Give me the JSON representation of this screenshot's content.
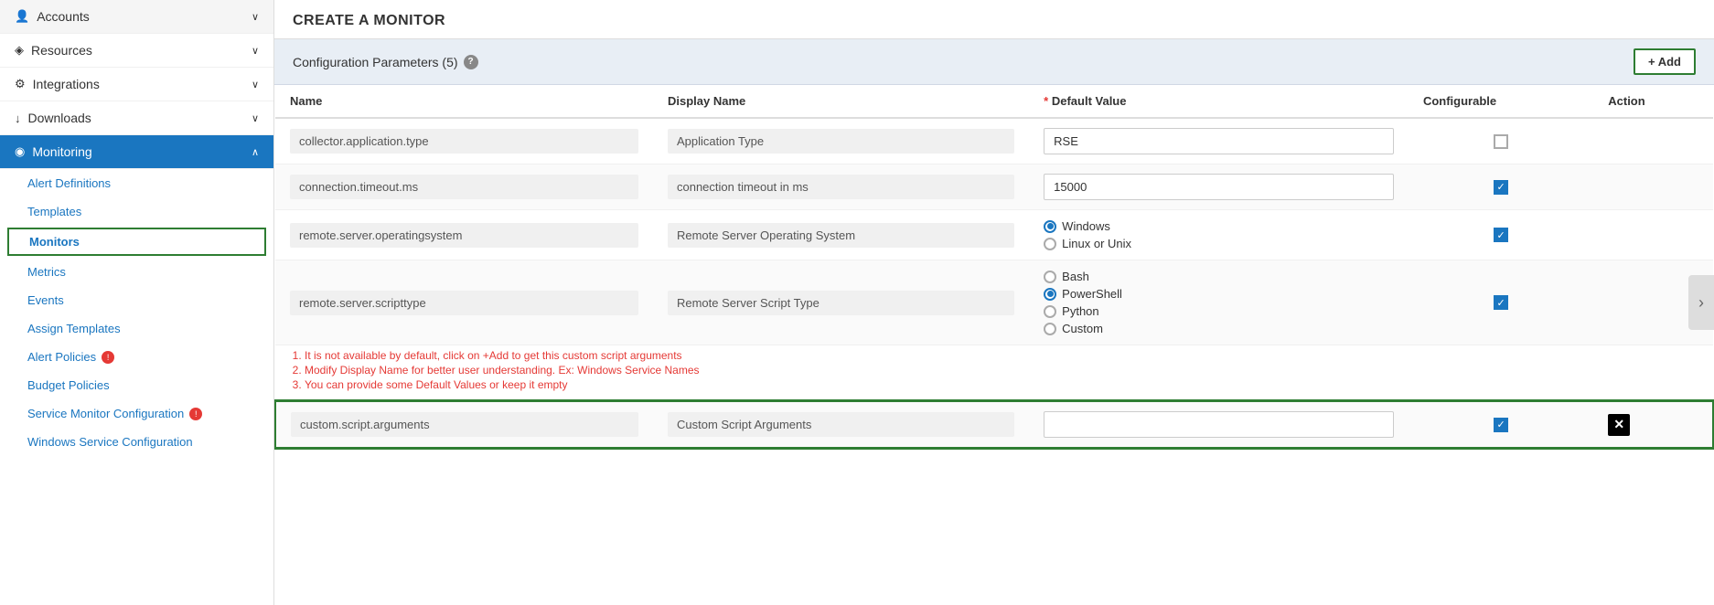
{
  "sidebar": {
    "items": [
      {
        "id": "accounts",
        "label": "Accounts",
        "icon": "👤",
        "chevron": "∨",
        "active": false,
        "level": 0
      },
      {
        "id": "resources",
        "label": "Resources",
        "icon": "◈",
        "chevron": "∨",
        "active": false,
        "level": 0
      },
      {
        "id": "integrations",
        "label": "Integrations",
        "icon": "⚙",
        "chevron": "∨",
        "active": false,
        "level": 0
      },
      {
        "id": "downloads",
        "label": "Downloads",
        "icon": "↓",
        "chevron": "∨",
        "active": false,
        "level": 0
      },
      {
        "id": "monitoring",
        "label": "Monitoring",
        "icon": "◉",
        "chevron": "∧",
        "active": true,
        "level": 0
      }
    ],
    "sub_items": [
      {
        "id": "alert-definitions",
        "label": "Alert Definitions",
        "highlighted": false,
        "badge": false
      },
      {
        "id": "templates",
        "label": "Templates",
        "highlighted": false,
        "badge": false
      },
      {
        "id": "monitors",
        "label": "Monitors",
        "highlighted": true,
        "badge": false
      },
      {
        "id": "metrics",
        "label": "Metrics",
        "highlighted": false,
        "badge": false
      },
      {
        "id": "events",
        "label": "Events",
        "highlighted": false,
        "badge": false
      },
      {
        "id": "assign-templates",
        "label": "Assign Templates",
        "highlighted": false,
        "badge": false
      },
      {
        "id": "alert-policies",
        "label": "Alert Policies",
        "highlighted": false,
        "badge": true
      },
      {
        "id": "budget-policies",
        "label": "Budget Policies",
        "highlighted": false,
        "badge": false
      },
      {
        "id": "service-monitor-configuration",
        "label": "Service Monitor Configuration",
        "highlighted": false,
        "badge": true
      },
      {
        "id": "windows-service-configuration",
        "label": "Windows Service Configuration",
        "highlighted": false,
        "badge": false
      }
    ]
  },
  "page": {
    "title": "CREATE A MONITOR"
  },
  "config_params": {
    "section_title": "Configuration Parameters (5)",
    "help_icon": "?",
    "add_button": "+ Add",
    "columns": {
      "name": "Name",
      "display_name": "Display Name",
      "default_value": "* Default Value",
      "configurable": "Configurable",
      "action": "Action"
    },
    "rows": [
      {
        "id": "row1",
        "name": "collector.application.type",
        "display_name": "Application Type",
        "default_value_text": "RSE",
        "default_value_type": "text",
        "configurable": false,
        "highlighted": false
      },
      {
        "id": "row2",
        "name": "connection.timeout.ms",
        "display_name": "connection timeout in ms",
        "default_value_text": "15000",
        "default_value_type": "text",
        "configurable": true,
        "highlighted": false
      },
      {
        "id": "row3",
        "name": "remote.server.operatingsystem",
        "display_name": "Remote Server Operating System",
        "default_value_type": "radio",
        "radio_options": [
          {
            "label": "Windows",
            "selected": true
          },
          {
            "label": "Linux or Unix",
            "selected": false
          }
        ],
        "configurable": true,
        "highlighted": false
      },
      {
        "id": "row4",
        "name": "remote.server.scripttype",
        "display_name": "Remote Server Script Type",
        "default_value_type": "radio",
        "radio_options": [
          {
            "label": "Bash",
            "selected": false
          },
          {
            "label": "PowerShell",
            "selected": true
          },
          {
            "label": "Python",
            "selected": false
          },
          {
            "label": "Custom",
            "selected": false
          }
        ],
        "configurable": true,
        "highlighted": false
      },
      {
        "id": "row5",
        "name": "custom.script.arguments",
        "display_name": "Custom Script Arguments",
        "default_value_text": "",
        "default_value_type": "text",
        "configurable": true,
        "highlighted": true,
        "has_delete": true
      }
    ],
    "notes": [
      "It is not available by default, click on +Add to get this custom script arguments",
      "Modify Display Name for better user understanding. Ex: Windows Service Names",
      "You can provide some Default Values or keep it empty"
    ]
  },
  "right_arrow": "›"
}
